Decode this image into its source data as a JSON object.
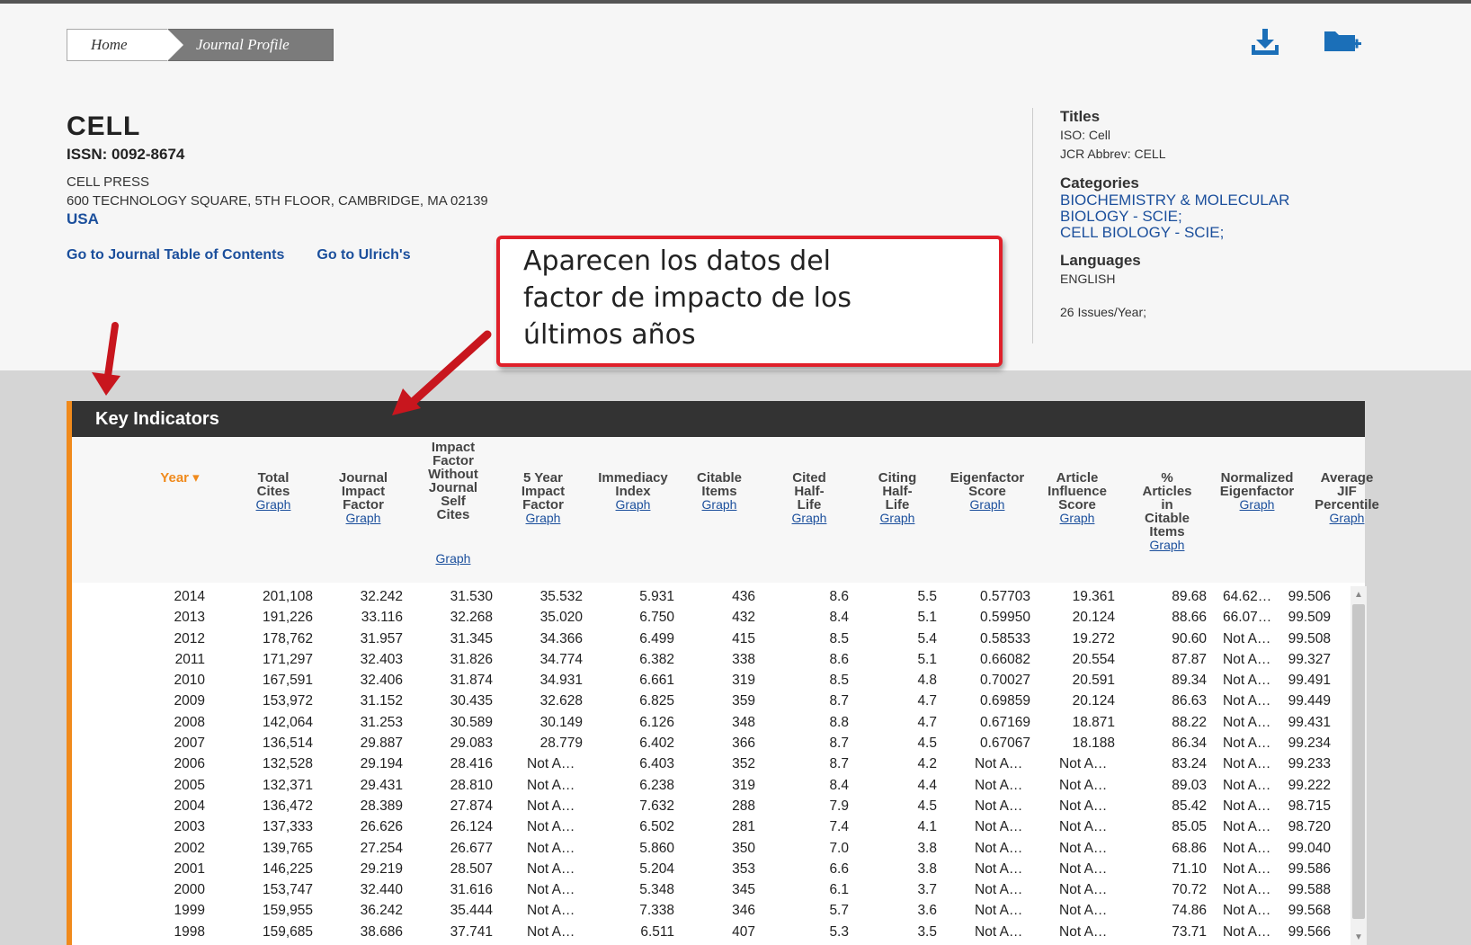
{
  "breadcrumb": {
    "home": "Home",
    "current": "Journal Profile"
  },
  "icons": {
    "download": "download-icon",
    "folder_add": "folder-add-icon"
  },
  "journal": {
    "title": "CELL",
    "issn": "ISSN: 0092-8674",
    "publisher": "CELL PRESS",
    "address": "600 TECHNOLOGY SQUARE, 5TH FLOOR, CAMBRIDGE, MA 02139",
    "country": "USA",
    "link_toc": "Go to Journal Table of Contents",
    "link_ulrich": "Go to Ulrich's"
  },
  "sidebar": {
    "titles_heading": "Titles",
    "iso": "ISO: Cell",
    "jcr_abbrev": "JCR Abbrev: CELL",
    "categories_heading": "Categories",
    "category_1a": "BIOCHEMISTRY & MOLECULAR",
    "category_1b": "BIOLOGY - SCIE;",
    "category_2": "CELL BIOLOGY - SCIE;",
    "languages_heading": "Languages",
    "language": "ENGLISH",
    "issues": "26 Issues/Year;"
  },
  "callout": {
    "text": "Aparecen los datos del\nfactor de impacto de los\núltimos años"
  },
  "panel": {
    "title": "Key Indicators"
  },
  "columns": [
    {
      "l1": "Year ▾",
      "graph": ""
    },
    {
      "l1": "Total",
      "l2": "Cites",
      "graph": "Graph"
    },
    {
      "l1": "Journal",
      "l2": "Impact",
      "l3": "Factor",
      "graph": "Graph"
    },
    {
      "l1": "Impact",
      "l2": "Factor",
      "l3": "Without",
      "l4": "Journal",
      "l5": "Self",
      "l6": "Cites",
      "graph": "Graph"
    },
    {
      "l1": "5 Year",
      "l2": "Impact",
      "l3": "Factor",
      "graph": "Graph"
    },
    {
      "l1": "Immediacy",
      "l2": "Index",
      "graph": "Graph"
    },
    {
      "l1": "Citable",
      "l2": "Items",
      "graph": "Graph"
    },
    {
      "l1": "Cited",
      "l2": "Half-",
      "l3": "Life",
      "graph": "Graph"
    },
    {
      "l1": "Citing",
      "l2": "Half-",
      "l3": "Life",
      "graph": "Graph"
    },
    {
      "l1": "Eigenfactor",
      "l2": "Score",
      "graph": "Graph"
    },
    {
      "l1": "Article",
      "l2": "Influence",
      "l3": "Score",
      "graph": "Graph"
    },
    {
      "l1": "%",
      "l2": "Articles",
      "l3": "in",
      "l4": "Citable",
      "l5": "Items",
      "graph": "Graph"
    },
    {
      "l1": "Normalized",
      "l2": "Eigenfactor",
      "graph": "Graph"
    },
    {
      "l1": "Average",
      "l2": "JIF",
      "l3": "Percentile",
      "graph": "Graph"
    }
  ],
  "rows": [
    [
      "2014",
      "201,108",
      "32.242",
      "31.530",
      "35.532",
      "5.931",
      "436",
      "8.6",
      "5.5",
      "0.57703",
      "19.361",
      "89.68",
      "64.62…",
      "99.506"
    ],
    [
      "2013",
      "191,226",
      "33.116",
      "32.268",
      "35.020",
      "6.750",
      "432",
      "8.4",
      "5.1",
      "0.59950",
      "20.124",
      "88.66",
      "66.07…",
      "99.509"
    ],
    [
      "2012",
      "178,762",
      "31.957",
      "31.345",
      "34.366",
      "6.499",
      "415",
      "8.5",
      "5.4",
      "0.58533",
      "19.272",
      "90.60",
      "Not A…",
      "99.508"
    ],
    [
      "2011",
      "171,297",
      "32.403",
      "31.826",
      "34.774",
      "6.382",
      "338",
      "8.6",
      "5.1",
      "0.66082",
      "20.554",
      "87.87",
      "Not A…",
      "99.327"
    ],
    [
      "2010",
      "167,591",
      "32.406",
      "31.874",
      "34.931",
      "6.661",
      "319",
      "8.5",
      "4.8",
      "0.70027",
      "20.591",
      "89.34",
      "Not A…",
      "99.491"
    ],
    [
      "2009",
      "153,972",
      "31.152",
      "30.435",
      "32.628",
      "6.825",
      "359",
      "8.7",
      "4.7",
      "0.69859",
      "20.124",
      "86.63",
      "Not A…",
      "99.449"
    ],
    [
      "2008",
      "142,064",
      "31.253",
      "30.589",
      "30.149",
      "6.126",
      "348",
      "8.8",
      "4.7",
      "0.67169",
      "18.871",
      "88.22",
      "Not A…",
      "99.431"
    ],
    [
      "2007",
      "136,514",
      "29.887",
      "29.083",
      "28.779",
      "6.402",
      "366",
      "8.7",
      "4.5",
      "0.67067",
      "18.188",
      "86.34",
      "Not A…",
      "99.234"
    ],
    [
      "2006",
      "132,528",
      "29.194",
      "28.416",
      "Not A…",
      "6.403",
      "352",
      "8.7",
      "4.2",
      "Not A…",
      "Not A…",
      "83.24",
      "Not A…",
      "99.233"
    ],
    [
      "2005",
      "132,371",
      "29.431",
      "28.810",
      "Not A…",
      "6.238",
      "319",
      "8.4",
      "4.4",
      "Not A…",
      "Not A…",
      "89.03",
      "Not A…",
      "99.222"
    ],
    [
      "2004",
      "136,472",
      "28.389",
      "27.874",
      "Not A…",
      "7.632",
      "288",
      "7.9",
      "4.5",
      "Not A…",
      "Not A…",
      "85.42",
      "Not A…",
      "98.715"
    ],
    [
      "2003",
      "137,333",
      "26.626",
      "26.124",
      "Not A…",
      "6.502",
      "281",
      "7.4",
      "4.1",
      "Not A…",
      "Not A…",
      "85.05",
      "Not A…",
      "98.720"
    ],
    [
      "2002",
      "139,765",
      "27.254",
      "26.677",
      "Not A…",
      "5.860",
      "350",
      "7.0",
      "3.8",
      "Not A…",
      "Not A…",
      "68.86",
      "Not A…",
      "99.040"
    ],
    [
      "2001",
      "146,225",
      "29.219",
      "28.507",
      "Not A…",
      "5.204",
      "353",
      "6.6",
      "3.8",
      "Not A…",
      "Not A…",
      "71.10",
      "Not A…",
      "99.586"
    ],
    [
      "2000",
      "153,747",
      "32.440",
      "31.616",
      "Not A…",
      "5.348",
      "345",
      "6.1",
      "3.7",
      "Not A…",
      "Not A…",
      "70.72",
      "Not A…",
      "99.588"
    ],
    [
      "1999",
      "159,955",
      "36.242",
      "35.444",
      "Not A…",
      "7.338",
      "346",
      "5.7",
      "3.6",
      "Not A…",
      "Not A…",
      "74.86",
      "Not A…",
      "99.568"
    ],
    [
      "1998",
      "159,685",
      "38.686",
      "37.741",
      "Not A…",
      "6.511",
      "407",
      "5.3",
      "3.5",
      "Not A…",
      "Not A…",
      "73.71",
      "Not A…",
      "99.566"
    ]
  ],
  "colors": {
    "accent": "#f08a1c",
    "link": "#1b4f9c",
    "callout_border": "#e0202a",
    "header_bar": "#333333"
  }
}
